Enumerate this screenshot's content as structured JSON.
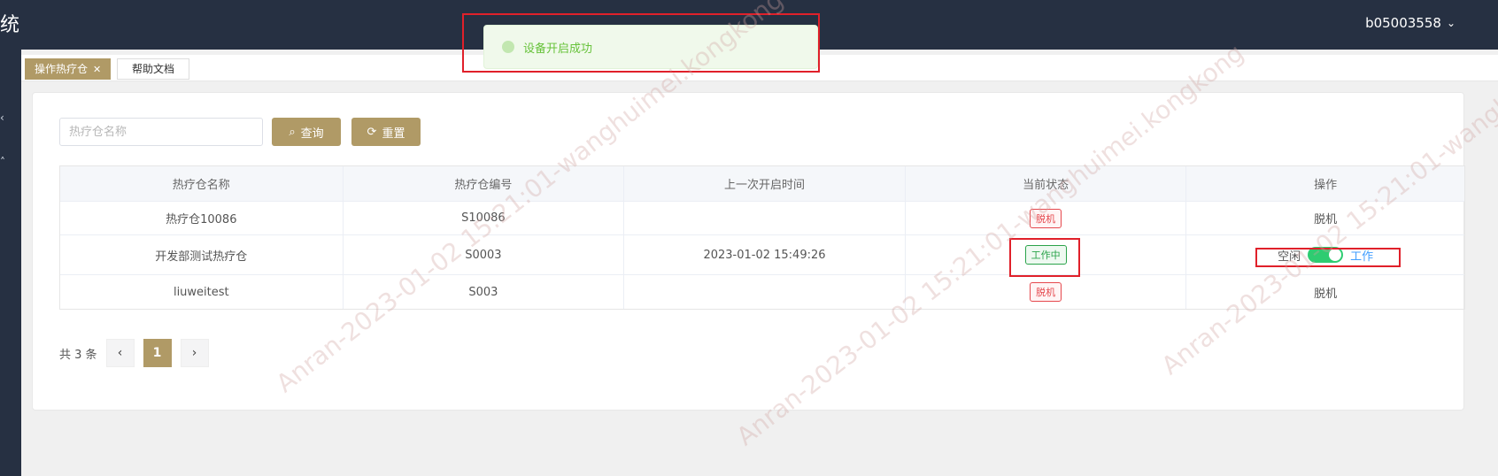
{
  "header": {
    "brand_fragment": "统",
    "username": "b05003558"
  },
  "toast": {
    "message": "设备开启成功"
  },
  "tabs": [
    {
      "label": "操作热疗仓",
      "active": true,
      "closeable": true
    },
    {
      "label": "帮助文档",
      "active": false,
      "closeable": false
    }
  ],
  "search": {
    "placeholder": "热疗仓名称",
    "query_label": "查询",
    "reset_label": "重置"
  },
  "table": {
    "columns": [
      "热疗仓名称",
      "热疗仓编号",
      "上一次开启时间",
      "当前状态",
      "操作"
    ],
    "rows": [
      {
        "name": "热疗仓10086",
        "code": "S10086",
        "last_open": "",
        "status": "脱机",
        "action": "脱机"
      },
      {
        "name": "开发部测试热疗仓",
        "code": "S0003",
        "last_open": "2023-01-02 15:49:26",
        "status": "工作中",
        "action_off": "空闲",
        "action_on": "工作",
        "switch_on": true
      },
      {
        "name": "liuweitest",
        "code": "S003",
        "last_open": "",
        "status": "脱机",
        "action": "脱机"
      }
    ]
  },
  "pagination": {
    "total_label": "共 3 条",
    "current_page": "1"
  },
  "watermark": "Anran-2023-01-02 15:21:01-wanghuimei.kongkong",
  "colors": {
    "topbar": "#263042",
    "accent": "#b09a66",
    "toast_green": "#67c23a",
    "status_red": "#e5484d",
    "status_green": "#2aa34a",
    "switch_green": "#2ecc71",
    "highlight_red": "#e0202a"
  }
}
